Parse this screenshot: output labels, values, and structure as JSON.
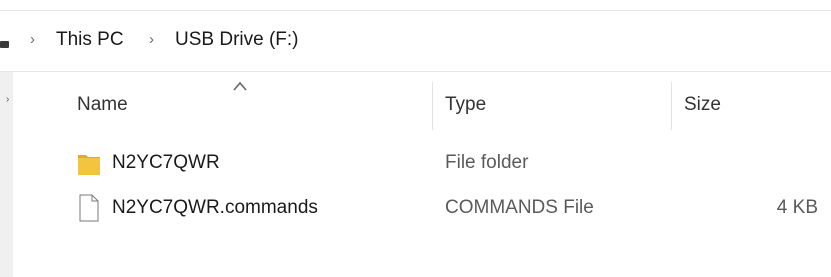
{
  "breadcrumb": {
    "items": [
      "This PC",
      "USB Drive (F:)"
    ],
    "separator": "›"
  },
  "columns": {
    "name": "Name",
    "type": "Type",
    "size": "Size",
    "sorted_by": "name",
    "sort_direction": "ascending"
  },
  "files": [
    {
      "name": "N2YC7QWR",
      "type": "File folder",
      "size": "",
      "icon": "folder-icon"
    },
    {
      "name": "N2YC7QWR.commands",
      "type": "COMMANDS File",
      "size": "4 KB",
      "icon": "file-icon"
    }
  ],
  "colors": {
    "folder": "#f3c440",
    "folder_dark": "#e4a72a",
    "nav_pane": "#f0f0f0"
  }
}
